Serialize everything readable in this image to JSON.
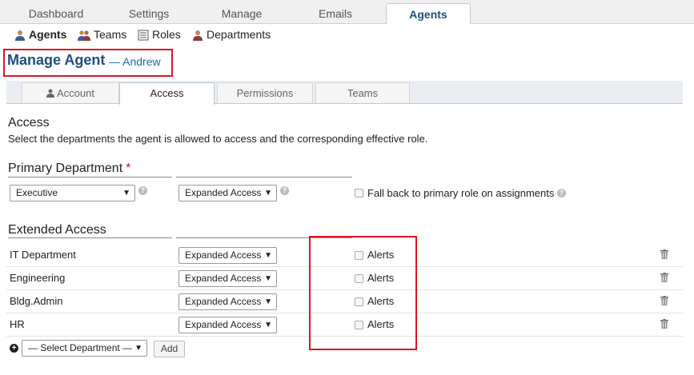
{
  "topnav": {
    "tabs": [
      {
        "label": "Dashboard"
      },
      {
        "label": "Settings"
      },
      {
        "label": "Manage"
      },
      {
        "label": "Emails"
      },
      {
        "label": "Agents"
      }
    ]
  },
  "subnav": {
    "items": [
      {
        "label": "Agents",
        "icon": "agent-icon"
      },
      {
        "label": "Teams",
        "icon": "teams-icon"
      },
      {
        "label": "Roles",
        "icon": "roles-icon"
      },
      {
        "label": "Departments",
        "icon": "departments-icon"
      }
    ]
  },
  "page": {
    "title": "Manage Agent",
    "subtitle": "— Andrew"
  },
  "tabs": [
    {
      "label": "Account",
      "icon": "user-icon"
    },
    {
      "label": "Access"
    },
    {
      "label": "Permissions"
    },
    {
      "label": "Teams"
    }
  ],
  "access": {
    "heading": "Access",
    "description": "Select the departments the agent is allowed to access and the corresponding effective role."
  },
  "primary": {
    "heading": "Primary Department",
    "required_mark": "*",
    "department": "Executive",
    "role": "Expanded Access",
    "fallback_label": "Fall back to primary role on assignments"
  },
  "extended": {
    "heading": "Extended Access",
    "rows": [
      {
        "department": "IT Department",
        "role": "Expanded Access",
        "alerts_label": "Alerts"
      },
      {
        "department": "Engineering",
        "role": "Expanded Access",
        "alerts_label": "Alerts"
      },
      {
        "department": "Bldg.Admin",
        "role": "Expanded Access",
        "alerts_label": "Alerts"
      },
      {
        "department": "HR",
        "role": "Expanded Access",
        "alerts_label": "Alerts"
      }
    ],
    "select_placeholder": "— Select Department —",
    "add_label": "Add"
  },
  "colors": {
    "accent": "#1e4e80",
    "highlight": "#e0141e",
    "required": "#d01010"
  },
  "glyphs": {
    "dropdown": "▼",
    "help": "?",
    "plus": "+"
  }
}
